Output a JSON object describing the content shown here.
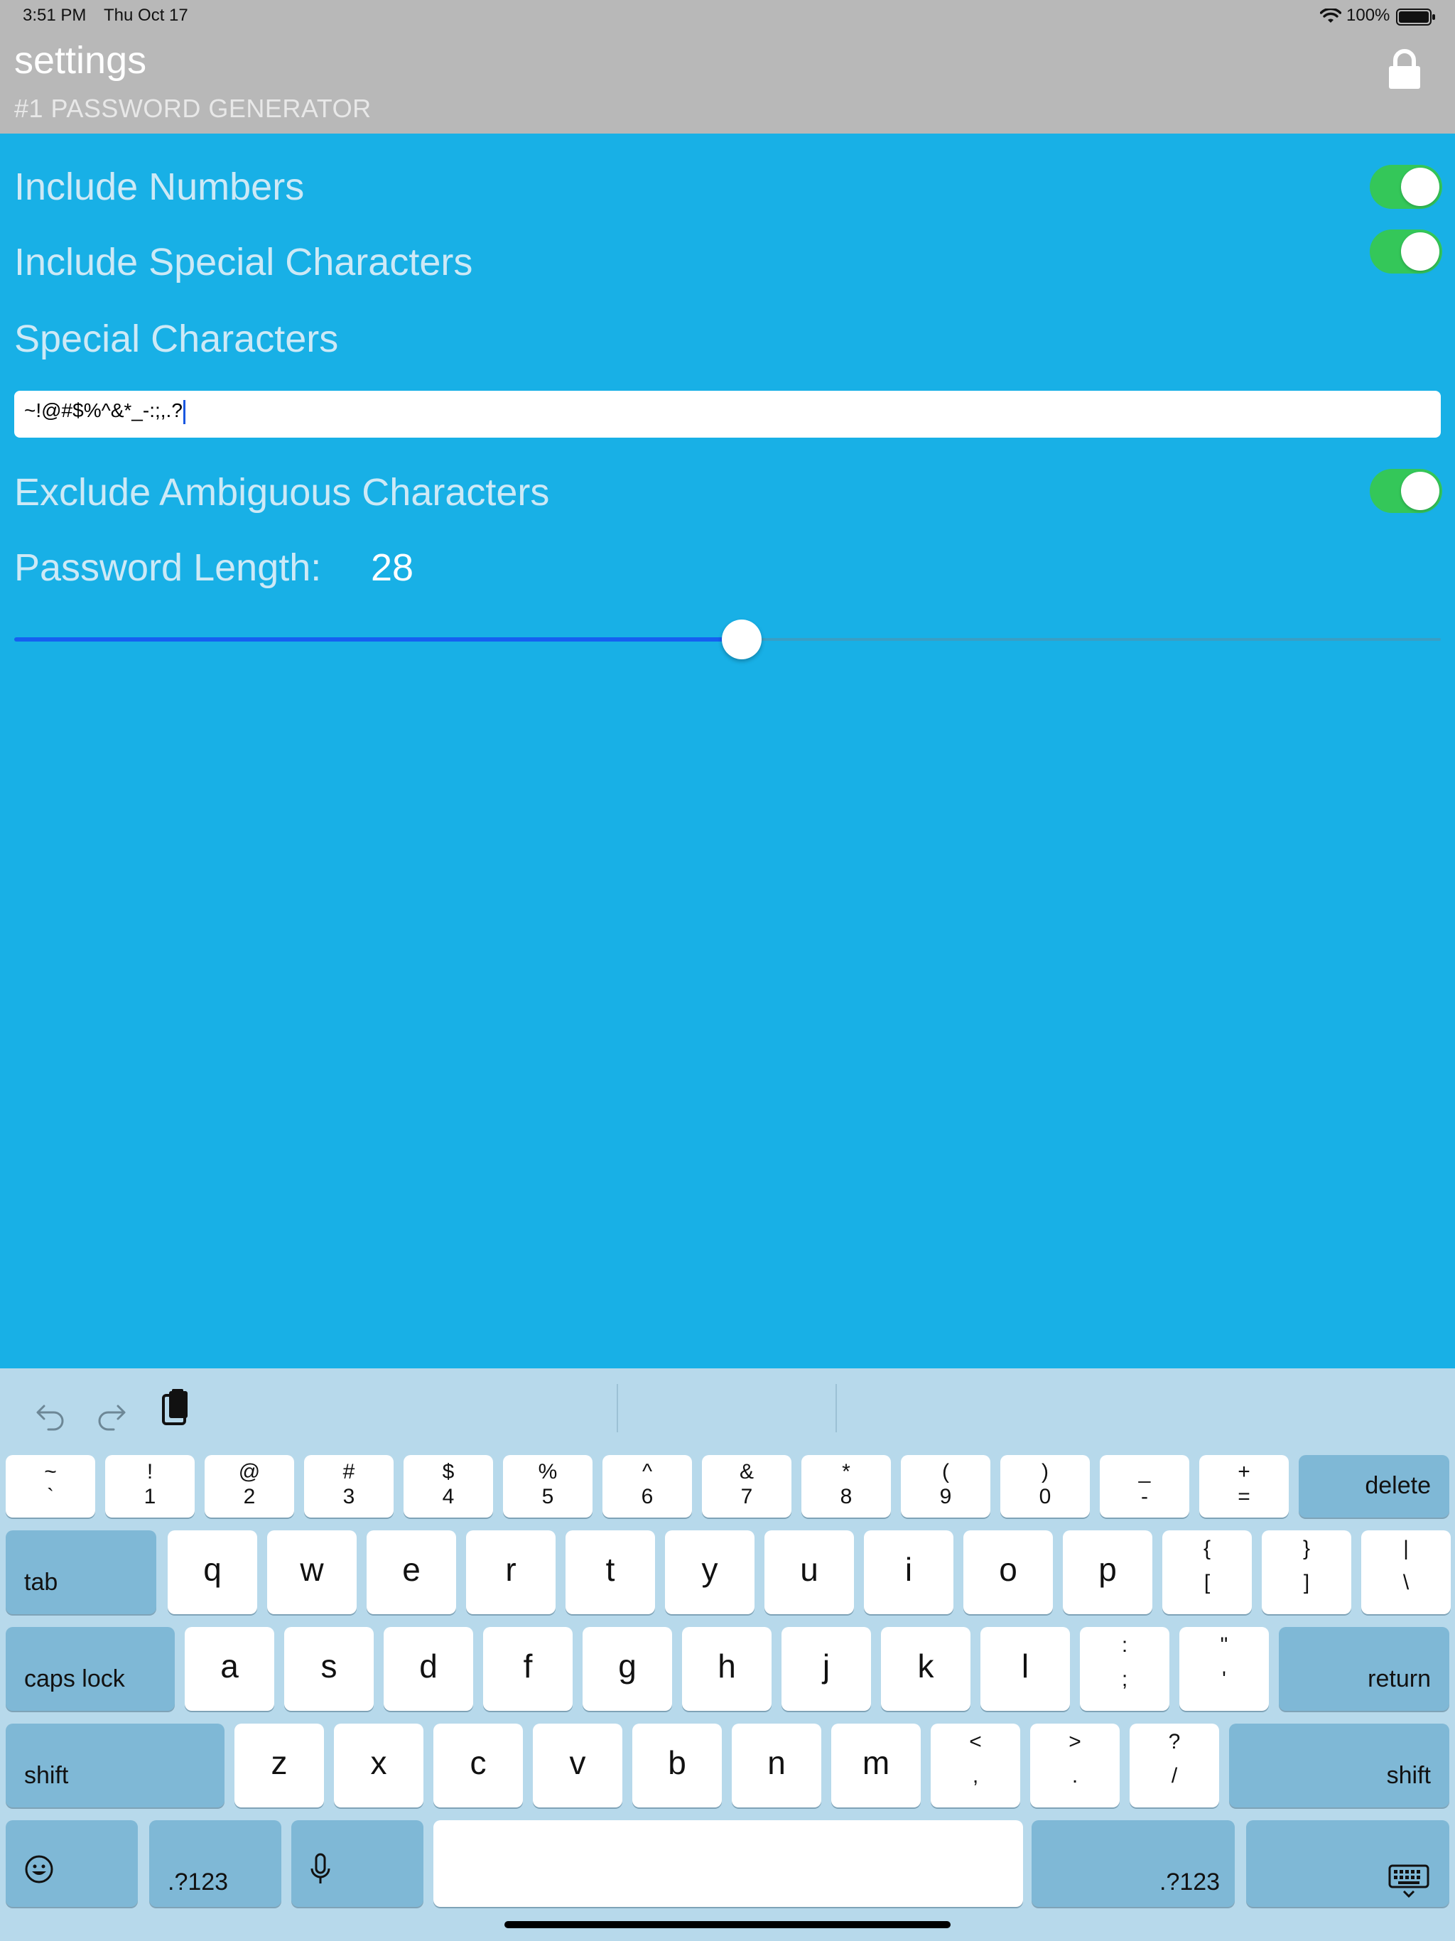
{
  "status_bar": {
    "time": "3:51 PM",
    "date": "Thu Oct 17",
    "battery": "100%"
  },
  "header": {
    "title": "settings",
    "subtitle": "#1 PASSWORD GENERATOR"
  },
  "settings": {
    "include_numbers": {
      "label": "Include Numbers",
      "on": true
    },
    "include_special": {
      "label": "Include Special Characters",
      "on": true
    },
    "special_chars_label": "Special Characters",
    "special_chars_value": "~!@#$%^&*_-:;,.?",
    "exclude_ambiguous": {
      "label": "Exclude Ambiguous Characters",
      "on": true
    },
    "password_length_label": "Password Length:",
    "password_length": "28",
    "slider_fraction": 0.51
  },
  "colors": {
    "background": "#18b0e6",
    "header": "#b8b8b8",
    "toggle_on": "#34c759",
    "slider_fill": "#1560f0",
    "keyboard": "#b7d9eb"
  },
  "keyboard": {
    "toolbar": [
      "undo-icon",
      "redo-icon",
      "paste-icon"
    ],
    "row1": [
      {
        "top": "~",
        "bot": "`"
      },
      {
        "top": "!",
        "bot": "1"
      },
      {
        "top": "@",
        "bot": "2"
      },
      {
        "top": "#",
        "bot": "3"
      },
      {
        "top": "$",
        "bot": "4"
      },
      {
        "top": "%",
        "bot": "5"
      },
      {
        "top": "^",
        "bot": "6"
      },
      {
        "top": "&",
        "bot": "7"
      },
      {
        "top": "*",
        "bot": "8"
      },
      {
        "top": "(",
        "bot": "9"
      },
      {
        "top": ")",
        "bot": "0"
      },
      {
        "top": "_",
        "bot": "-"
      },
      {
        "top": "+",
        "bot": "="
      }
    ],
    "delete": "delete",
    "tab": "tab",
    "row2": [
      "q",
      "w",
      "e",
      "r",
      "t",
      "y",
      "u",
      "i",
      "o",
      "p"
    ],
    "row2_sym": [
      {
        "top": "{",
        "bot": "["
      },
      {
        "top": "}",
        "bot": "]"
      },
      {
        "top": "|",
        "bot": "\\"
      }
    ],
    "caps_lock": "caps lock",
    "row3": [
      "a",
      "s",
      "d",
      "f",
      "g",
      "h",
      "j",
      "k",
      "l"
    ],
    "row3_sym": [
      {
        "top": ":",
        "bot": ";"
      },
      {
        "top": "\"",
        "bot": "'"
      }
    ],
    "return": "return",
    "shift_left": "shift",
    "row4": [
      "z",
      "x",
      "c",
      "v",
      "b",
      "n",
      "m"
    ],
    "row4_sym": [
      {
        "top": "<",
        "bot": ","
      },
      {
        "top": ">",
        "bot": "."
      },
      {
        "top": "?",
        "bot": "/"
      }
    ],
    "shift_right": "shift",
    "numbers_left": ".?123",
    "numbers_right": ".?123"
  }
}
